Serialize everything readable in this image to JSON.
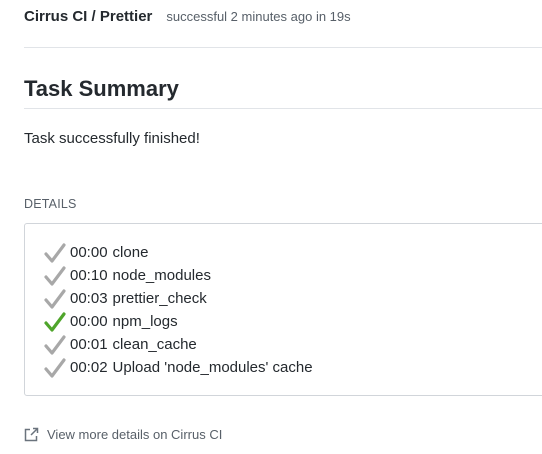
{
  "header": {
    "title": "Cirrus CI / Prettier",
    "status": "successful 2 minutes ago in 19s"
  },
  "main": {
    "title": "Task Summary",
    "summary": "Task successfully finished!",
    "details_label": "DETAILS",
    "steps": [
      {
        "time": "00:00",
        "name": "clone",
        "icon": "check-icon",
        "highlighted": false
      },
      {
        "time": "00:10",
        "name": "node_modules",
        "icon": "check-icon",
        "highlighted": false
      },
      {
        "time": "00:03",
        "name": "prettier_check",
        "icon": "check-icon",
        "highlighted": false
      },
      {
        "time": "00:00",
        "name": "npm_logs",
        "icon": "check-icon",
        "highlighted": true
      },
      {
        "time": "00:01",
        "name": "clean_cache",
        "icon": "check-icon",
        "highlighted": false
      },
      {
        "time": "00:02",
        "name": "Upload 'node_modules' cache",
        "icon": "check-icon",
        "highlighted": false
      }
    ],
    "more_link": "View more details on Cirrus CI",
    "more_link_icon": "external-link-icon"
  },
  "colors": {
    "check_default": "#a8a8a8",
    "check_highlight": "#4fa52b",
    "text": "#24292e",
    "muted": "#586069",
    "border": "#d1d5da"
  }
}
